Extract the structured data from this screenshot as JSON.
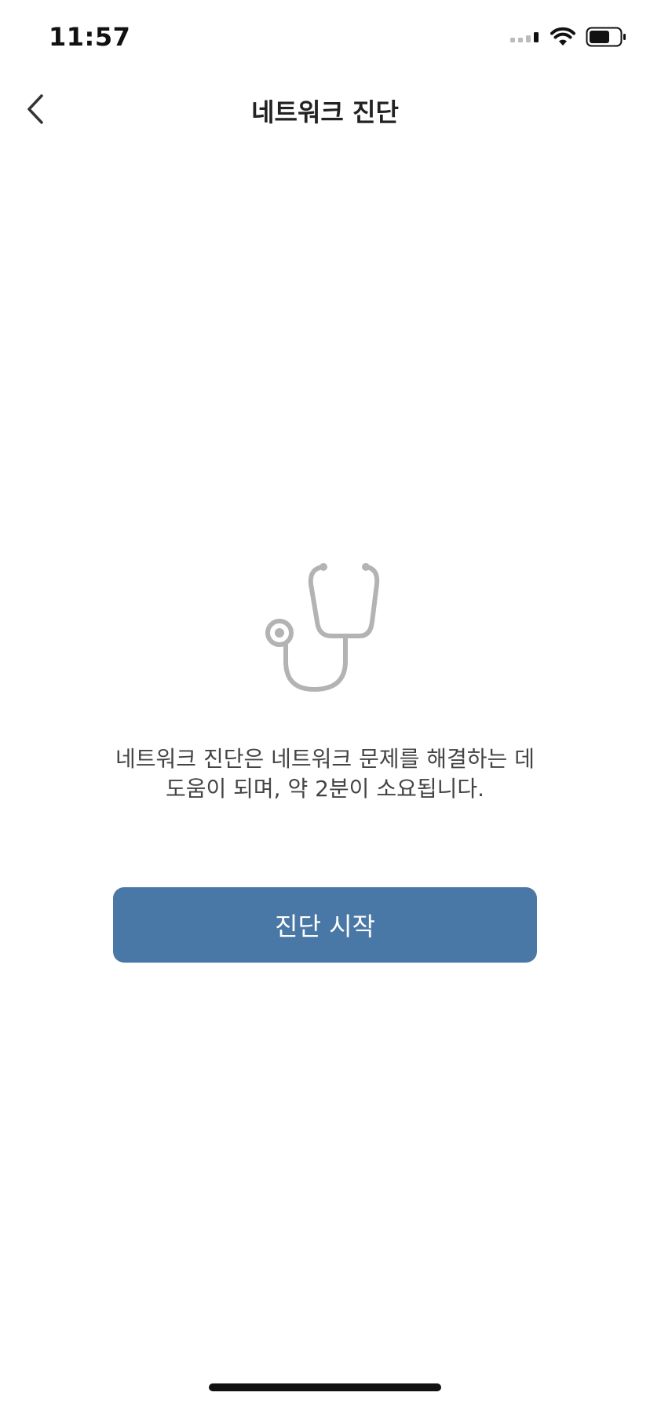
{
  "status_bar": {
    "time": "11:57"
  },
  "nav": {
    "title": "네트워크 진단"
  },
  "illustration": {
    "icon": "stethoscope-icon",
    "color": "#b3b3b3"
  },
  "description": {
    "line1": "네트워크 진단은 네트워크 문제를 해결하는 데",
    "line2": "도움이 되며, 약 2분이 소요됩니다."
  },
  "start_button": {
    "label": "진단 시작",
    "color": "#4a78a6"
  }
}
